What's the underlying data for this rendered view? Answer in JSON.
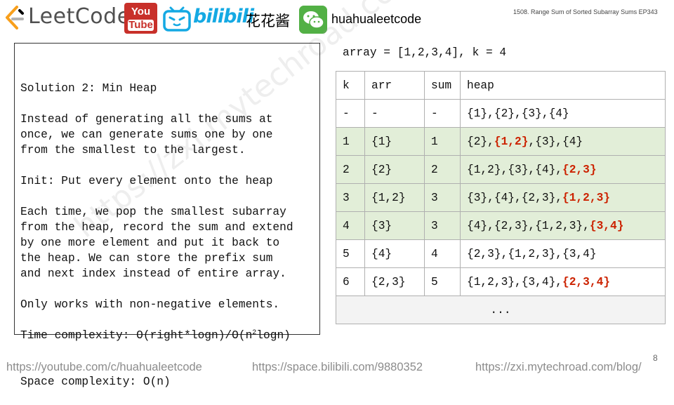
{
  "header": {
    "brand": "LeetCode",
    "youtube_icon": {
      "line1": "You",
      "line2": "Tube"
    },
    "bilibili_text": "bilibili",
    "channel_name": "花花酱",
    "wechat_name": "huahualeetcode",
    "episode": "1508. Range Sum of Sorted Subarray Sums EP343"
  },
  "solution": {
    "lines": [
      "Solution 2: Min Heap",
      "",
      "Instead of generating all the sums at",
      "once, we can generate sums one by one",
      "from the smallest to the largest.",
      "",
      "Init: Put every element onto the heap",
      "",
      "Each time, we pop the smallest subarray",
      "from the heap, record the sum and extend",
      "by one more element and put it back to",
      "the heap. We can store the prefix sum",
      "and next index instead of entire array.",
      "",
      "Only works with non-negative elements.",
      ""
    ],
    "time_complexity": {
      "prefix": "Time complexity: O(right*logn)/O(n",
      "exp": "2",
      "suffix": "logn)"
    },
    "space_complexity": "Space complexity: O(n)"
  },
  "array_line": "array = [1,2,3,4], k = 4",
  "table": {
    "headers": [
      "k",
      "arr",
      "sum",
      "heap"
    ],
    "rows": [
      {
        "k": "-",
        "arr": "-",
        "sum": "-",
        "heap": [
          [
            "{1},{2},{3},{4}",
            false
          ]
        ],
        "highlight": false
      },
      {
        "k": "1",
        "arr": "{1}",
        "sum": "1",
        "heap": [
          [
            "{2},",
            false
          ],
          [
            "{1,2}",
            true
          ],
          [
            ",{3},{4}",
            false
          ]
        ],
        "highlight": true
      },
      {
        "k": "2",
        "arr": "{2}",
        "sum": "2",
        "heap": [
          [
            "{1,2},{3},{4},",
            false
          ],
          [
            "{2,3}",
            true
          ]
        ],
        "highlight": true
      },
      {
        "k": "3",
        "arr": "{1,2}",
        "sum": "3",
        "heap": [
          [
            "{3},{4},{2,3},",
            false
          ],
          [
            "{1,2,3}",
            true
          ]
        ],
        "highlight": true
      },
      {
        "k": "4",
        "arr": "{3}",
        "sum": "3",
        "heap": [
          [
            "{4},{2,3},{1,2,3},",
            false
          ],
          [
            "{3,4}",
            true
          ]
        ],
        "highlight": true
      },
      {
        "k": "5",
        "arr": "{4}",
        "sum": "4",
        "heap": [
          [
            "{2,3},{1,2,3},{3,4}",
            false
          ]
        ],
        "highlight": false
      },
      {
        "k": "6",
        "arr": "{2,3}",
        "sum": "5",
        "heap": [
          [
            "{1,2,3},{3,4},",
            false
          ],
          [
            "{2,3,4}",
            true
          ]
        ],
        "highlight": false
      }
    ],
    "ellipsis": "..."
  },
  "colors": {
    "highlight_row": "#e2eed8",
    "new_entry": "#cc2200",
    "bilibili": "#14a9e3",
    "youtube": "#c8302a",
    "wechat": "#52b045"
  },
  "footer": {
    "youtube": "https://youtube.com/c/huahualeetcode",
    "bilibili": "https://space.bilibili.com/9880352",
    "blog": "https://zxi.mytechroad.com/blog/"
  },
  "page_number": "8",
  "watermark": "https://zxi.mytechroad.com 花花酱 LeetCode"
}
